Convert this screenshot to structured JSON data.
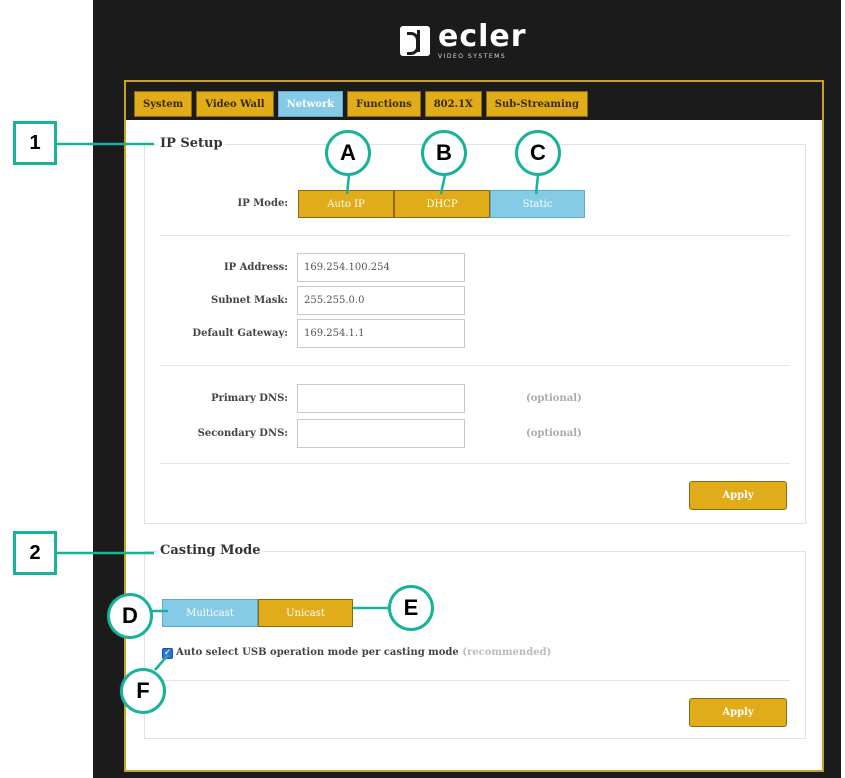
{
  "brand": {
    "name": "ecler",
    "subtitle": "VIDEO SYSTEMS"
  },
  "tabs": [
    {
      "label": "System",
      "active": false
    },
    {
      "label": "Video Wall",
      "active": false
    },
    {
      "label": "Network",
      "active": true
    },
    {
      "label": "Functions",
      "active": false
    },
    {
      "label": "802.1X",
      "active": false
    },
    {
      "label": "Sub-Streaming",
      "active": false
    }
  ],
  "ip_setup": {
    "legend": "IP Setup",
    "ip_mode_label": "IP Mode:",
    "modes": {
      "auto_ip": "Auto IP",
      "dhcp": "DHCP",
      "static": "Static"
    },
    "selected_mode": "Static",
    "ip_address_label": "IP Address:",
    "ip_address_value": "169.254.100.254",
    "subnet_mask_label": "Subnet Mask:",
    "subnet_mask_value": "255.255.0.0",
    "default_gateway_label": "Default Gateway:",
    "default_gateway_value": "169.254.1.1",
    "primary_dns_label": "Primary DNS:",
    "primary_dns_value": "",
    "secondary_dns_label": "Secondary DNS:",
    "secondary_dns_value": "",
    "optional_note": "(optional)",
    "apply_label": "Apply"
  },
  "casting_mode": {
    "legend": "Casting Mode",
    "multicast_label": "Multicast",
    "unicast_label": "Unicast",
    "selected_mode": "Multicast",
    "usb_auto_label": "Auto select USB operation mode per casting mode",
    "usb_auto_note": "(recommended)",
    "usb_auto_checked": true,
    "apply_label": "Apply"
  },
  "annotations": {
    "box_1": "1",
    "box_2": "2",
    "circle_a": "A",
    "circle_b": "B",
    "circle_c": "C",
    "circle_d": "D",
    "circle_e": "E",
    "circle_f": "F"
  },
  "colors": {
    "accent_gold": "#e1ac1a",
    "accent_blue": "#86cbe6",
    "frame_dark": "#1b1b1b",
    "frame_border": "#c8a028",
    "callout_teal": "#17b29a",
    "checkbox_blue": "#2f6fd6"
  }
}
